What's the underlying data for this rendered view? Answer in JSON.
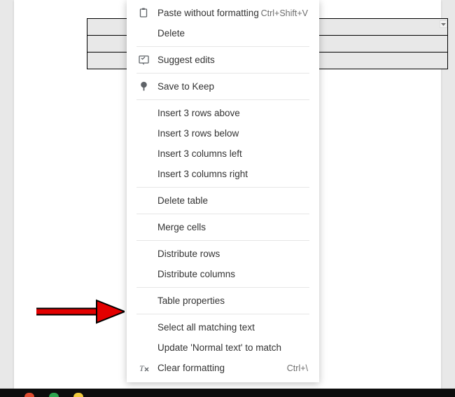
{
  "menu": {
    "items": [
      {
        "label": "Paste without formatting",
        "shortcut": "Ctrl+Shift+V",
        "icon": "paste-plain"
      },
      {
        "label": "Delete"
      },
      {
        "divider": true
      },
      {
        "label": "Suggest edits",
        "icon": "suggest"
      },
      {
        "divider": true
      },
      {
        "label": "Save to Keep",
        "icon": "keep"
      },
      {
        "divider": true
      },
      {
        "label": "Insert 3 rows above"
      },
      {
        "label": "Insert 3 rows below"
      },
      {
        "label": "Insert 3 columns left"
      },
      {
        "label": "Insert 3 columns right"
      },
      {
        "divider": true
      },
      {
        "label": "Delete table"
      },
      {
        "divider": true
      },
      {
        "label": "Merge cells"
      },
      {
        "divider": true
      },
      {
        "label": "Distribute rows"
      },
      {
        "label": "Distribute columns"
      },
      {
        "divider": true
      },
      {
        "label": "Table properties"
      },
      {
        "divider": true
      },
      {
        "label": "Select all matching text"
      },
      {
        "label": "Update 'Normal text' to match"
      },
      {
        "label": "Clear formatting",
        "shortcut": "Ctrl+\\",
        "icon": "clear-format"
      }
    ]
  },
  "table": {
    "rows": 3,
    "cols": 1
  },
  "annotation": {
    "arrow_points_to": "Table properties"
  }
}
